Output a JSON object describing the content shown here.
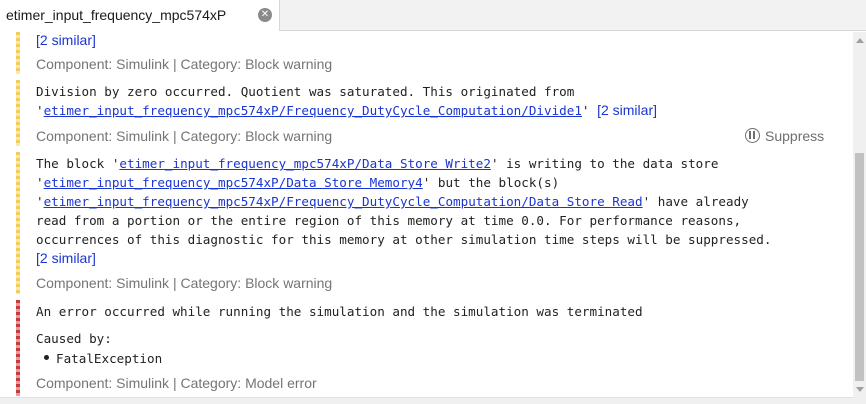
{
  "tab": {
    "title": "etimer_input_frequency_mpc574xP"
  },
  "messages": [
    {
      "severity": "warning",
      "similar": "[2 similar]",
      "meta": "Component:  Simulink | Category:  Block warning"
    },
    {
      "severity": "warning",
      "line1": "Division by zero occurred. Quotient was saturated. This originated from",
      "link1": "etimer_input_frequency_mpc574xP/Frequency_DutyCycle_Computation/Divide1",
      "similar": "[2 similar]",
      "meta": "Component:  Simulink | Category:  Block warning",
      "suppress_label": "Suppress"
    },
    {
      "severity": "warning",
      "l1_pre": "The block '",
      "link_a": "etimer_input_frequency_mpc574xP/Data Store Write2",
      "l1_post": "' is writing to the data store",
      "link_b": "etimer_input_frequency_mpc574xP/Data Store Memory4",
      "l2_post": "' but the block(s)",
      "link_c": "etimer_input_frequency_mpc574xP/Frequency_DutyCycle_Computation/Data Store Read",
      "l3_post": "' have already",
      "line4": "read from a portion or the entire region of this memory at time 0.0. For performance reasons,",
      "line5": "occurrences of this diagnostic for this memory at other simulation time steps will be suppressed.",
      "similar": "[2 similar]",
      "meta": "Component:  Simulink | Category:  Block warning"
    },
    {
      "severity": "error",
      "line1": "An error occurred while running the simulation and the simulation was terminated",
      "caused_by": "Caused by:",
      "cause_item": "FatalException",
      "meta": "Component:  Simulink | Category:  Model error"
    }
  ],
  "colors": {
    "warning": "#f5cb5c",
    "error": "#c43c3c",
    "link": "#1a35d1"
  }
}
